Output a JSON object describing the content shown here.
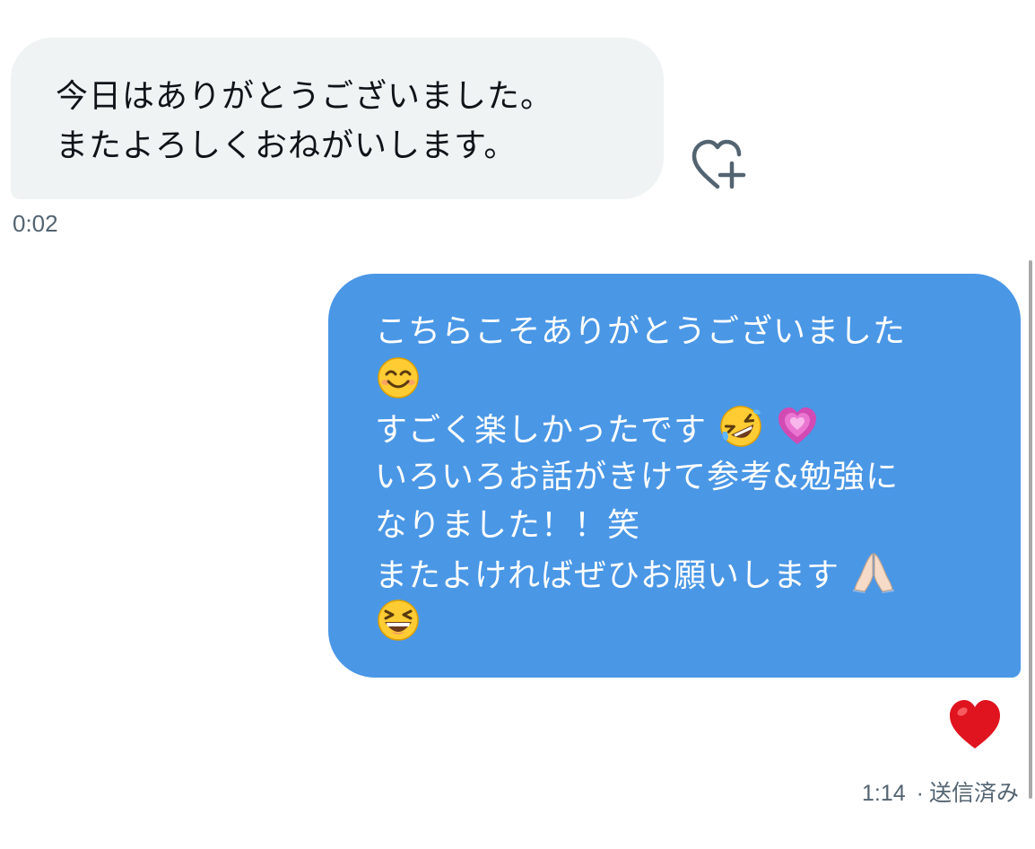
{
  "incoming": {
    "lines": [
      "今日はありがとうございました。",
      "またよろしくおねがいします。"
    ],
    "timestamp": "0:02",
    "reaction_button_icon": "heart-plus-icon"
  },
  "outgoing": {
    "lines": [
      {
        "text": "こちらこそありがとうございました",
        "emojis": []
      },
      {
        "text": "",
        "emojis": [
          "smiling-face-icon"
        ]
      },
      {
        "text": "すごく楽しかったです",
        "emojis": [
          "rofl-face-icon",
          "growing-heart-icon"
        ]
      },
      {
        "text": "いろいろお話がきけて参考&勉強に",
        "emojis": []
      },
      {
        "text": "なりました！！笑",
        "emojis": []
      },
      {
        "text": "またよければぜひお願いします",
        "emojis": [
          "folded-hands-icon"
        ]
      },
      {
        "text": "",
        "emojis": [
          "grinning-squinting-face-icon"
        ]
      }
    ],
    "reaction": "red-heart-icon",
    "timestamp": "1:14",
    "status_separator": "·",
    "status": "送信済み"
  },
  "colors": {
    "incoming_bubble": "#eff3f4",
    "outgoing_bubble": "#4a97e6",
    "meta_text": "#536471",
    "reaction_heart": "#e0141e"
  }
}
